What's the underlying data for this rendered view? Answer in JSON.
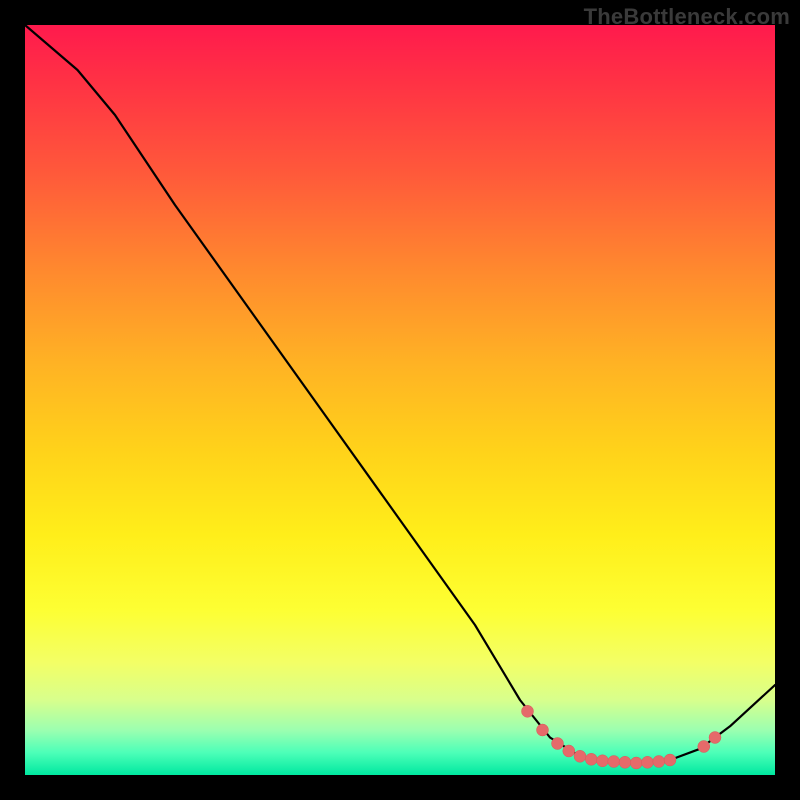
{
  "watermark": "TheBottleneck.com",
  "chart_data": {
    "type": "line",
    "title": "",
    "xlabel": "",
    "ylabel": "",
    "xlim": [
      0,
      100
    ],
    "ylim": [
      0,
      100
    ],
    "note": "Curve y values are normalized 0–100 (0 = bottom/green, 100 = top/red). x is 0–100 left→right.",
    "curve": [
      {
        "x": 0,
        "y": 100
      },
      {
        "x": 7,
        "y": 94
      },
      {
        "x": 12,
        "y": 88
      },
      {
        "x": 20,
        "y": 76
      },
      {
        "x": 30,
        "y": 62
      },
      {
        "x": 40,
        "y": 48
      },
      {
        "x": 50,
        "y": 34
      },
      {
        "x": 60,
        "y": 20
      },
      {
        "x": 66,
        "y": 10
      },
      {
        "x": 70,
        "y": 5
      },
      {
        "x": 74,
        "y": 2.5
      },
      {
        "x": 78,
        "y": 1.8
      },
      {
        "x": 82,
        "y": 1.6
      },
      {
        "x": 86,
        "y": 2.0
      },
      {
        "x": 90,
        "y": 3.5
      },
      {
        "x": 94,
        "y": 6.5
      },
      {
        "x": 100,
        "y": 12
      }
    ],
    "markers": [
      {
        "x": 67,
        "y": 8.5
      },
      {
        "x": 69,
        "y": 6.0
      },
      {
        "x": 71,
        "y": 4.2
      },
      {
        "x": 72.5,
        "y": 3.2
      },
      {
        "x": 74,
        "y": 2.5
      },
      {
        "x": 75.5,
        "y": 2.1
      },
      {
        "x": 77,
        "y": 1.9
      },
      {
        "x": 78.5,
        "y": 1.8
      },
      {
        "x": 80,
        "y": 1.7
      },
      {
        "x": 81.5,
        "y": 1.6
      },
      {
        "x": 83,
        "y": 1.7
      },
      {
        "x": 84.5,
        "y": 1.8
      },
      {
        "x": 86,
        "y": 2.0
      },
      {
        "x": 90.5,
        "y": 3.8
      },
      {
        "x": 92,
        "y": 5.0
      }
    ],
    "marker_radius_px": 6
  }
}
